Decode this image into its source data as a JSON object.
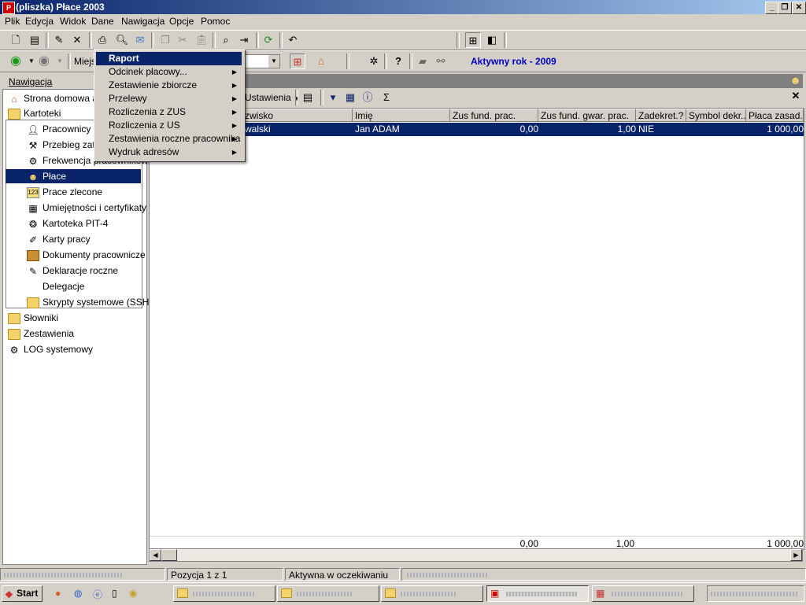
{
  "window": {
    "title": "(pliszka)  Płace 2003"
  },
  "menubar": [
    "Plik",
    "Edycja",
    "Widok",
    "Dane",
    "Nawigacja",
    "Opcje",
    "Pomoc"
  ],
  "toolbar2": {
    "location_label": "Miejs",
    "active_year": "Aktywny rok - 2009"
  },
  "nav": {
    "header": "Nawigacja",
    "home": "Strona domowa ap",
    "kartoteki": "Kartoteki",
    "items": [
      "Pracownicy",
      "Przebieg zatru",
      "Frekwencja pracowników",
      "Płace",
      "Prace zlecone",
      "Umiejętności i certyfikaty",
      "Kartoteka PIT-4",
      "Karty pracy",
      "Dokumenty pracownicze",
      "Deklaracje roczne",
      "Delegacje",
      "Skrypty systemowe (SSH)"
    ],
    "selected": "Płace",
    "roots": [
      "Słowniki",
      "Zestawienia",
      "LOG systemowy"
    ]
  },
  "main": {
    "toolbar_label": "Ustawienia",
    "sigma": "Σ",
    "columns": [
      "Nazwisko",
      "Imię",
      "Zus fund. prac.",
      "Zus fund. gwar. prac.",
      "Zadekret.?",
      "Symbol dekr...",
      "Płaca zasad."
    ],
    "columns_visible": [
      "zwisko",
      "Imię",
      "Zus fund. prac.",
      "Zus fund. gwar. prac.",
      "Zadekret.?",
      "Symbol dekr...",
      "Płaca zasad."
    ],
    "row": {
      "nazwisko": "walski",
      "imie": "Jan ADAM",
      "zus_fund": "0,00",
      "zus_gwar": "1,00",
      "zadekret": "NIE",
      "symbol": "",
      "placa": "1 000,00"
    },
    "totals": {
      "zus_fund": "0,00",
      "zus_gwar": "1,00",
      "placa": "1 000,00"
    }
  },
  "popup": {
    "items": [
      {
        "label": "Raport",
        "submenu": false
      },
      {
        "label": "Odcinek płacowy...",
        "submenu": true
      },
      {
        "label": "Zestawienie zbiorcze",
        "submenu": true
      },
      {
        "label": "Przelewy",
        "submenu": true
      },
      {
        "label": "Rozliczenia z ZUS",
        "submenu": true
      },
      {
        "label": "Rozliczenia z US",
        "submenu": true
      },
      {
        "label": "Zestawienia roczne pracownika",
        "submenu": true
      },
      {
        "label": "Wydruk adresów",
        "submenu": true
      }
    ]
  },
  "status": {
    "position": "Pozycja 1 z 1",
    "state": "Aktywna w oczekiwaniu"
  },
  "taskbar": {
    "start": "Start"
  },
  "colors": {
    "titlebar": "#0a246a",
    "selection": "#0a246a",
    "active_year": "#0000c0",
    "face": "#d4d0c8"
  }
}
